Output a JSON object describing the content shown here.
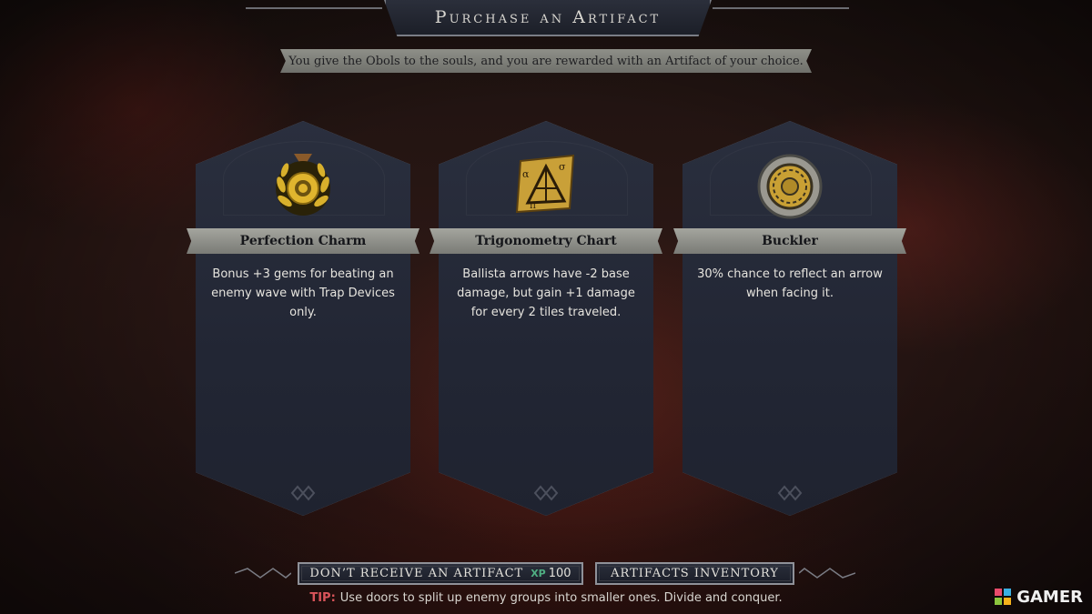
{
  "header": {
    "title": "Purchase an Artifact",
    "subtitle": "You give the Obols to the souls, and you are rewarded with an Artifact of your choice."
  },
  "cards": [
    {
      "name": "Perfection Charm",
      "icon": "laurel-medal-icon",
      "description": "Bonus +3 gems for beating an enemy wave with Trap Devices only."
    },
    {
      "name": "Trigonometry Chart",
      "icon": "triangle-chart-icon",
      "description": "Ballista arrows have -2 base damage, but gain +1 damage for every 2 tiles traveled."
    },
    {
      "name": "Buckler",
      "icon": "round-shield-icon",
      "description": "30% chance to reflect an arrow when facing it."
    }
  ],
  "footer": {
    "decline_label": "DON’T RECEIVE AN ARTIFACT",
    "decline_cost": "100",
    "decline_cost_icon": "XP",
    "inventory_label": "ARTIFACTS INVENTORY",
    "tip_label": "TIP:",
    "tip_text": "Use doors to split up enemy groups into smaller ones. Divide and conquer."
  },
  "watermark": "GAMER",
  "colors": {
    "accent_red": "#d9545a",
    "xp_green": "#4fae82",
    "gold": "#c9a02a"
  }
}
